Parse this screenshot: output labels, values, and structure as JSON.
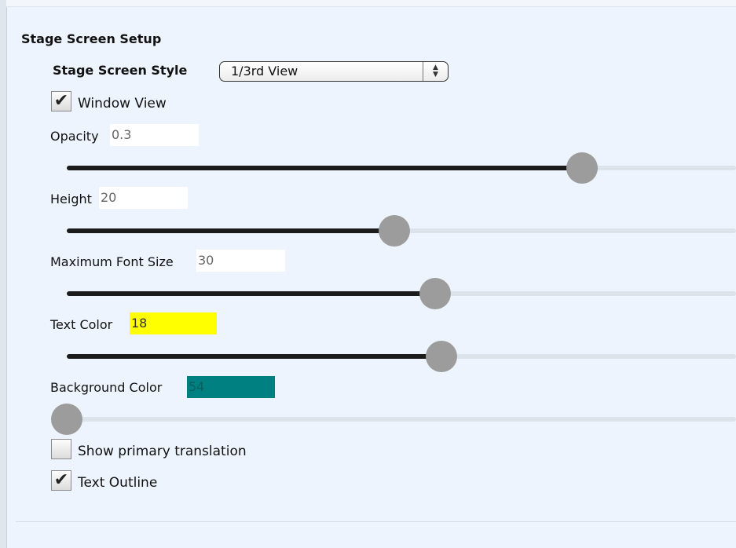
{
  "section": {
    "title": "Stage Screen Setup"
  },
  "stage_screen_style": {
    "label": "Stage Screen Style",
    "selected": "1/3rd View"
  },
  "window_view": {
    "label": "Window View",
    "checked": true
  },
  "opacity": {
    "label": "Opacity",
    "value": "0.3",
    "slider_fraction": 0.77
  },
  "height": {
    "label": "Height",
    "value": "20",
    "slider_fraction": 0.49
  },
  "max_font_size": {
    "label": "Maximum Font Size",
    "value": "30",
    "slider_fraction": 0.55
  },
  "text_color": {
    "label": "Text Color",
    "value": "18",
    "swatch_color": "#ffff00",
    "slider_fraction": 0.56
  },
  "background_color": {
    "label": "Background Color",
    "value": "54",
    "swatch_color": "#008080",
    "slider_fraction": 0.0
  },
  "show_primary_translation": {
    "label": "Show primary translation",
    "checked": false
  },
  "text_outline": {
    "label": "Text Outline",
    "checked": true
  }
}
